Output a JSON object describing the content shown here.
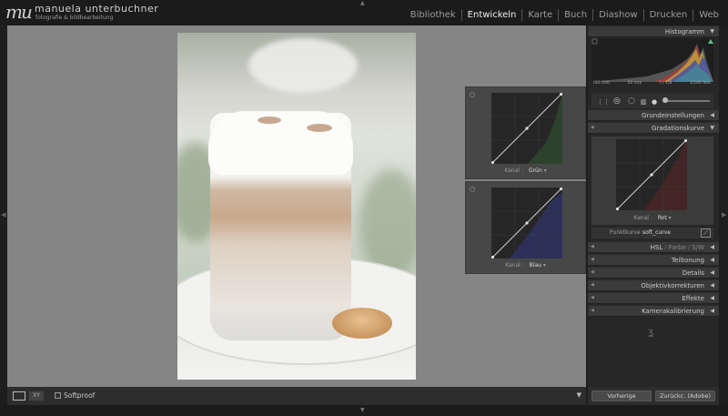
{
  "brand": {
    "logo": "mu",
    "name": "manuela unterbuchner",
    "tagline": "fotografie & bildbearbeitung"
  },
  "modules": [
    {
      "label": "Bibliothek",
      "active": false
    },
    {
      "label": "Entwickeln",
      "active": true
    },
    {
      "label": "Karte",
      "active": false
    },
    {
      "label": "Buch",
      "active": false
    },
    {
      "label": "Diashow",
      "active": false
    },
    {
      "label": "Drucken",
      "active": false
    },
    {
      "label": "Web",
      "active": false
    }
  ],
  "histogram": {
    "title": "Histogramm",
    "iso": "ISO 200",
    "focal": "50 mm",
    "aperture": "f / 1,8",
    "shutter": "1/160 Sek."
  },
  "sections": {
    "grundeinstellungen": "Grundeinstellungen",
    "gradationskurve": "Gradationskurve",
    "hsl": "HSL",
    "farbe": "Farbe",
    "sw": "S/W",
    "teiltonung": "Teiltonung",
    "details": "Details",
    "objektivkorrekturen": "Objektivkorrekturen",
    "effekte": "Effekte",
    "kamerakalibrierung": "Kamerakalibrierung"
  },
  "curves": {
    "kanal_label": "Kanal :",
    "green_value": "Grün",
    "blue_value": "Blau",
    "red_value": "Rot",
    "punktkurve_label": "Punktkurve :",
    "punktkurve_value": "soft_curve"
  },
  "toolbar": {
    "compare_label": "XY",
    "softproof_label": "Softproof"
  },
  "buttons": {
    "previous": "Vorherige",
    "reset": "Zurückc. (Adobe)"
  },
  "colors": {
    "accent_green": "#5aa65a",
    "accent_blue": "#4a55b5",
    "accent_red": "#b54a4a"
  }
}
